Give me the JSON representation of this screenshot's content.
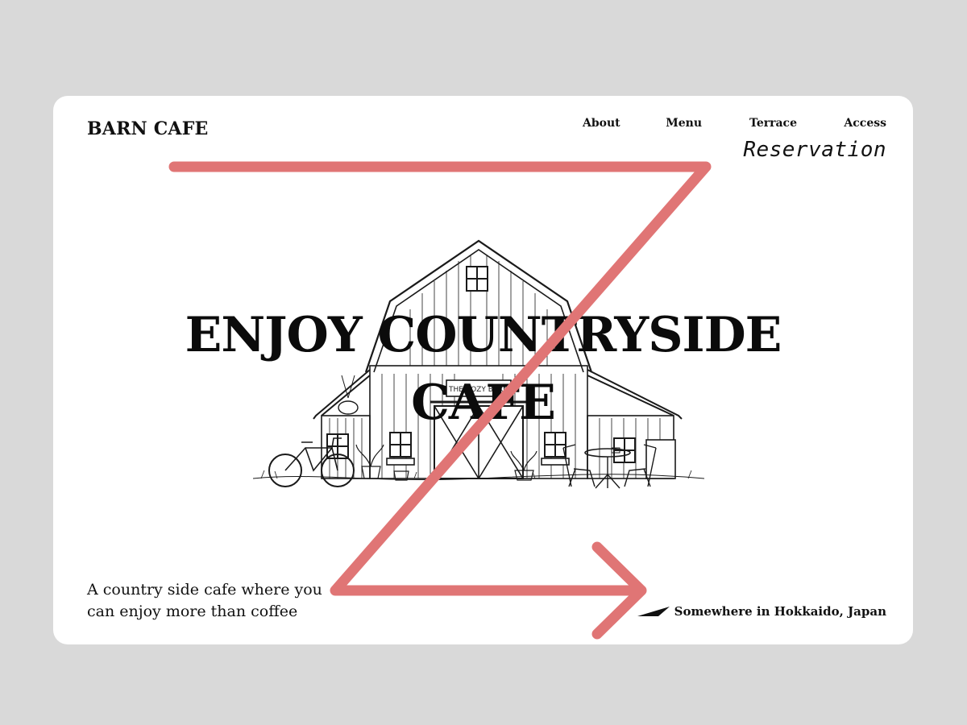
{
  "brand": {
    "logo": "BARN CAFE"
  },
  "nav": {
    "items": [
      "About",
      "Menu",
      "Terrace",
      "Access"
    ],
    "reservation": "Reservation"
  },
  "hero": {
    "headline_line1": "ENJOY COUNTRYSIDE",
    "headline_line2": "CAFE",
    "illustration_sign": "THE COZY BARN"
  },
  "footer": {
    "tagline": "A country side cafe where you can enjoy more than coffee",
    "location": "Somewhere in Hokkaido, Japan"
  },
  "colors": {
    "page_background": "#d9d9d9",
    "card_background": "#ffffff",
    "z_pattern_stroke": "#e07575",
    "text": "#111111"
  },
  "icons": {
    "location": "paper-plane-icon"
  }
}
